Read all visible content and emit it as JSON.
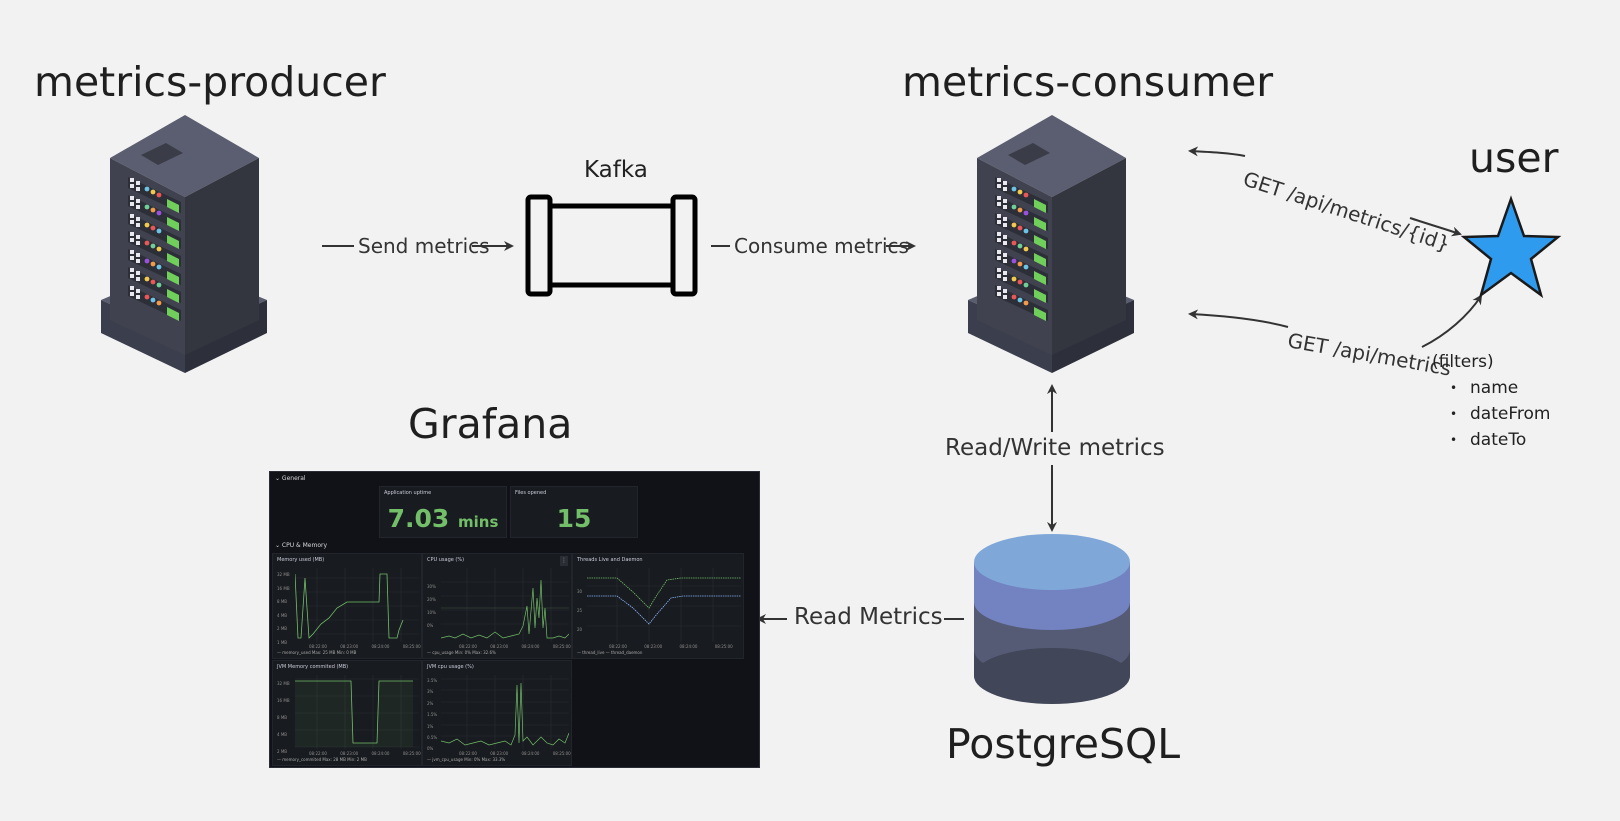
{
  "nodes": {
    "producer": {
      "title": "metrics-producer"
    },
    "kafka": {
      "title": "Kafka"
    },
    "consumer": {
      "title": "metrics-consumer"
    },
    "user": {
      "title": "user"
    },
    "grafana": {
      "title": "Grafana"
    },
    "postgres": {
      "title": "PostgreSQL"
    }
  },
  "edges": {
    "send": "Send metrics",
    "consume": "Consume metrics",
    "get_by_id": "GET /api/metrics/{id}",
    "get_list": "GET /api/metrics",
    "read_write": "Read/Write metrics",
    "read": "Read Metrics"
  },
  "filters": {
    "caption": "(filters)",
    "items": [
      "name",
      "dateFrom",
      "dateTo"
    ]
  },
  "dashboard": {
    "row_general": "⌄ General",
    "uptime_caption": "Application uptime",
    "uptime_value": "7.03",
    "uptime_unit": "mins",
    "files_caption": "Files opened",
    "files_value": "15",
    "row_cpu": "⌄ CPU & Memory",
    "panels": [
      {
        "title": "Memory used (MB)",
        "legend": "— memory_used  Max: 25 MB  Min: 0 MB",
        "yticks": [
          "32 MB",
          "16 MB",
          "8 MB",
          "4 MB",
          "2 MB",
          "1 MB"
        ]
      },
      {
        "title": "CPU usage (%)",
        "legend": "— cpu_usage  Min: 0%  Max: 32.6%",
        "yticks": [
          "30%",
          "20%",
          "10%",
          "0%"
        ]
      },
      {
        "title": "Threads Live and Daemon",
        "legend": "— thread_live  — thread_daemon",
        "yticks": [
          "30",
          "25",
          "20"
        ]
      },
      {
        "title": "JVM Memory commited (MB)",
        "legend": "— memory_commited  Max: 28 MB  Min: 2 MB",
        "yticks": [
          "32 MB",
          "16 MB",
          "8 MB",
          "4 MB",
          "2 MB"
        ]
      },
      {
        "title": "JVM cpu usage (%)",
        "legend": "— jvm_cpu_usage  Min: 0%  Max: 33.3%",
        "yticks": [
          "3.5%",
          "3%",
          "2%",
          "1.5%",
          "1%",
          "0.5%",
          "0%"
        ]
      }
    ],
    "xticks": [
      "08:22:00",
      "08:23:00",
      "08:24:00",
      "08:25:00"
    ]
  },
  "colors": {
    "background": "#f2f2f2",
    "star": "#2f9bef",
    "db_top": "#7fa8d9",
    "db_mid": "#7383c2",
    "db_low": "#545a73",
    "db_base": "#414658",
    "grafana_green": "#73bf69"
  }
}
